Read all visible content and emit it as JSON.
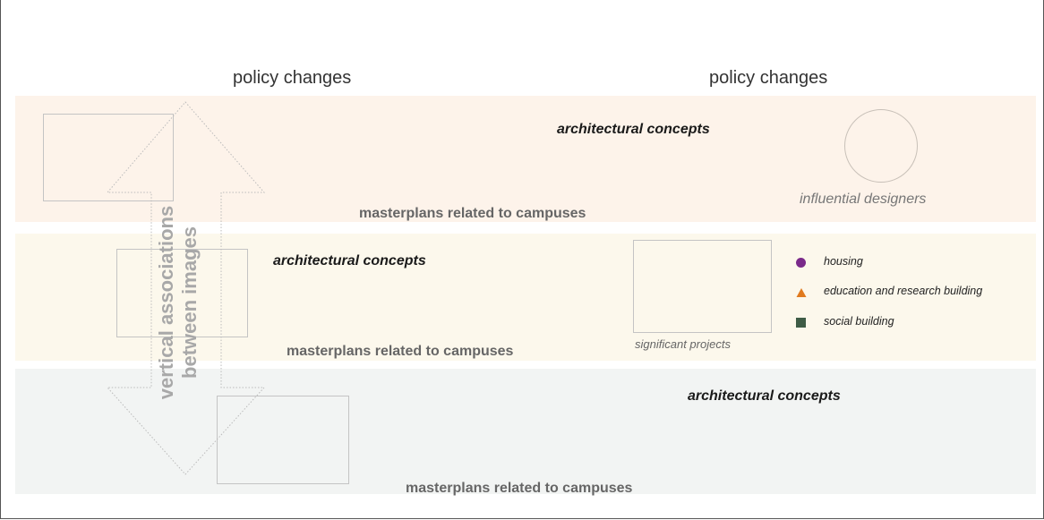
{
  "header": {
    "policy_left": "policy changes",
    "policy_right": "policy changes"
  },
  "colors": {
    "band_top": "#fdf3ea",
    "band_middle": "#fcf8ec",
    "band_bottom": "#f2f4f3",
    "housing": "#7a2a8a",
    "education": "#e07a1e",
    "social": "#3e5c46"
  },
  "bands": [
    {
      "concept": "architectural concepts",
      "masterplan": "masterplans related to campuses"
    },
    {
      "concept": "architectural concepts",
      "masterplan": "masterplans related to campuses"
    },
    {
      "concept": "architectural concepts",
      "masterplan": "masterplans related to campuses"
    }
  ],
  "designers": {
    "label": "influential designers",
    "shape": "circle"
  },
  "projects": {
    "label": "significant projects"
  },
  "arrow": {
    "line1": "vertical associations",
    "line2": "between images"
  },
  "legend": [
    {
      "label": "housing",
      "shape": "circle",
      "icon": "circle-icon"
    },
    {
      "label": "education and research building",
      "shape": "triangle",
      "icon": "triangle-icon"
    },
    {
      "label": "social building",
      "shape": "square",
      "icon": "square-icon"
    }
  ]
}
